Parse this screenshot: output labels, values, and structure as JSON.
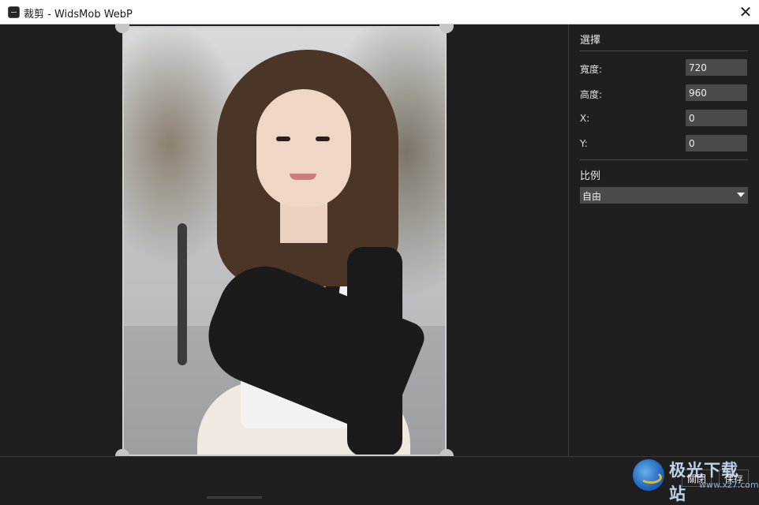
{
  "window": {
    "title": "裁剪 - WidsMob WebP",
    "close_glyph": "✕"
  },
  "panel": {
    "selection_title": "選擇",
    "fields": [
      {
        "label": "寬度:",
        "value": "720"
      },
      {
        "label": "高度:",
        "value": "960"
      },
      {
        "label": "X:",
        "value": "0"
      },
      {
        "label": "Y:",
        "value": "0"
      }
    ],
    "ratio_title": "比例",
    "ratio_value": "自由"
  },
  "footer": {
    "close_label": "關閉",
    "save_label": "保存"
  },
  "watermark": {
    "text": "极光下载站",
    "url": "www.xz7.com"
  },
  "colors": {
    "background": "#1f1f1f",
    "input_bg": "#4a4a4a",
    "handle": "#c6c6c6"
  }
}
